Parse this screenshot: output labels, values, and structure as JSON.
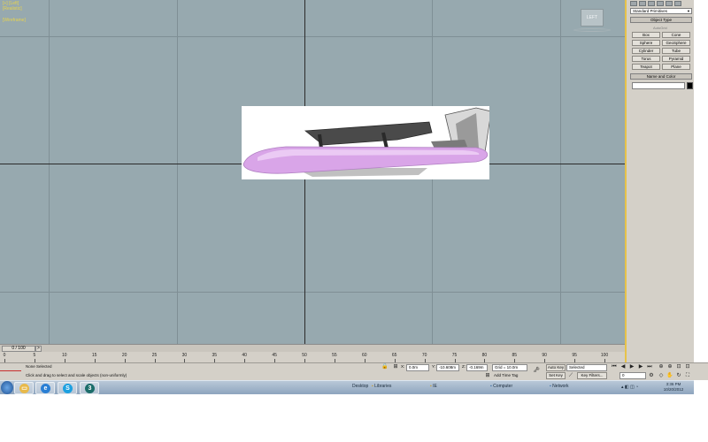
{
  "viewport": {
    "corner_labels": [
      "[+] [Left]",
      "[Realistic]",
      "[Wireframe]"
    ],
    "viewcube_label": "LEFT"
  },
  "command_panel": {
    "category_dropdown": "Standard Primitives",
    "object_type_header": "Object Type",
    "autogrid_label": "AutoGrid",
    "primitives": [
      "Box",
      "Cone",
      "Sphere",
      "GeoSphere",
      "Cylinder",
      "Tube",
      "Torus",
      "Pyramid",
      "Teapot",
      "Plane"
    ],
    "name_color_header": "Name and Color",
    "name_value": ""
  },
  "time_slider": {
    "position": "0 / 100",
    "next_label": ">"
  },
  "trackbar": {
    "ticks": [
      "0",
      "5",
      "10",
      "15",
      "20",
      "25",
      "30",
      "35",
      "40",
      "45",
      "50",
      "55",
      "60",
      "65",
      "70",
      "75",
      "80",
      "85",
      "90",
      "95",
      "100"
    ]
  },
  "status": {
    "selection_text": "None Selected",
    "prompt_text": "Click and drag to select and scale objects (non-uniformly)",
    "x_label": "X:",
    "x_value": "0.0m",
    "y_label": "Y:",
    "y_value": "-10.608m",
    "z_label": "Z:",
    "z_value": "-0.169m",
    "grid_text": "Grid = 10.0m",
    "add_time_tag": "Add Time Tag",
    "auto_key": "Auto Key",
    "auto_key_dropdown": "Selected",
    "set_key": "Set Key",
    "key_filters": "Key Filters...",
    "frame_value": "0"
  },
  "taskbar": {
    "desktop_label": "Desktop",
    "libraries_label": "Libraries",
    "ie_label": "IE",
    "computer_label": "Computer",
    "network_label": "Network",
    "clock_time": "3:36 PM",
    "clock_date": "10/20/2012"
  },
  "colors": {
    "viewport_bg": "#97a9af",
    "fuselage": "#d9a5e8",
    "panel_bg": "#d4d0c8",
    "panel_accent": "#e6c24a"
  }
}
